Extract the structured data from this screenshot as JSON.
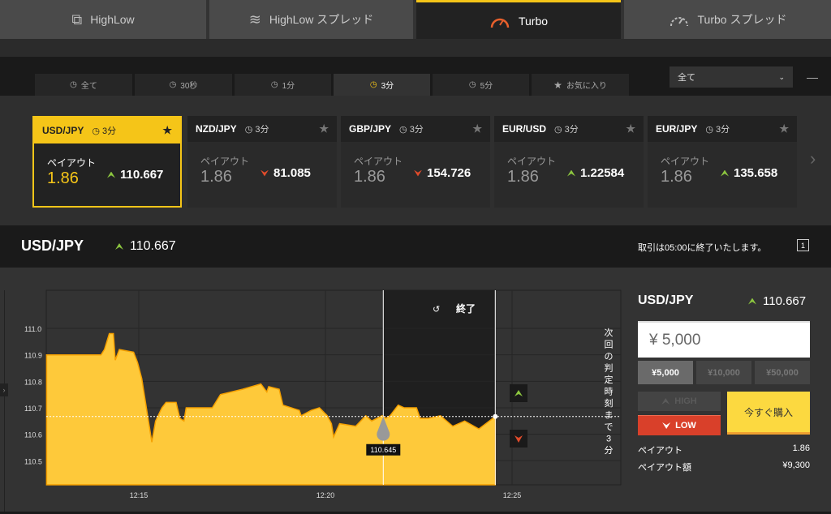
{
  "top_tabs": [
    {
      "label": "HighLow",
      "icon": "highlow-icon"
    },
    {
      "label": "HighLow スプレッド",
      "icon": "highlow-spread-icon"
    },
    {
      "label": "Turbo",
      "icon": "speedometer-icon"
    },
    {
      "label": "Turbo スプレッド",
      "icon": "speedometer-dashed-icon"
    }
  ],
  "filter_tabs": [
    "全て",
    "30秒",
    "1分",
    "3分",
    "5分",
    "お気に入り"
  ],
  "dropdown": {
    "value": "全て"
  },
  "cards": [
    {
      "pair": "USD/JPY",
      "time": "3分",
      "payout_label": "ペイアウト",
      "payout": "1.86",
      "rate": "110.667",
      "dir": "up"
    },
    {
      "pair": "NZD/JPY",
      "time": "3分",
      "payout_label": "ペイアウト",
      "payout": "1.86",
      "rate": "81.085",
      "dir": "down"
    },
    {
      "pair": "GBP/JPY",
      "time": "3分",
      "payout_label": "ペイアウト",
      "payout": "1.86",
      "rate": "154.726",
      "dir": "down"
    },
    {
      "pair": "EUR/USD",
      "time": "3分",
      "payout_label": "ペイアウト",
      "payout": "1.86",
      "rate": "1.22584",
      "dir": "up"
    },
    {
      "pair": "EUR/JPY",
      "time": "3分",
      "payout_label": "ペイアウト",
      "payout": "1.86",
      "rate": "135.658",
      "dir": "up"
    }
  ],
  "header": {
    "pair": "USD/JPY",
    "rate": "110.667",
    "notice": "取引は05:00に終了いたします。",
    "window_icon_label": "1"
  },
  "chart_data": {
    "type": "area",
    "y_ticks": [
      "111.0",
      "110.9",
      "110.8",
      "110.7",
      "110.6",
      "110.5"
    ],
    "x_ticks": [
      "12:15",
      "12:20",
      "12:25"
    ],
    "ylim": [
      110.4,
      111.15
    ],
    "x_unit": "minutes after 12:00",
    "points": [
      [
        12.53,
        110.9
      ],
      [
        13.99,
        110.9
      ],
      [
        14.08,
        110.92
      ],
      [
        14.21,
        110.98
      ],
      [
        14.32,
        110.98
      ],
      [
        14.37,
        110.88
      ],
      [
        14.48,
        110.92
      ],
      [
        14.86,
        110.91
      ],
      [
        14.97,
        110.87
      ],
      [
        15.08,
        110.81
      ],
      [
        15.18,
        110.72
      ],
      [
        15.35,
        110.57
      ],
      [
        15.45,
        110.65
      ],
      [
        15.62,
        110.7
      ],
      [
        15.73,
        110.72
      ],
      [
        16.0,
        110.72
      ],
      [
        16.1,
        110.66
      ],
      [
        16.21,
        110.65
      ],
      [
        16.27,
        110.7
      ],
      [
        16.7,
        110.7
      ],
      [
        16.97,
        110.7
      ],
      [
        17.19,
        110.75
      ],
      [
        17.78,
        110.77
      ],
      [
        18.27,
        110.79
      ],
      [
        18.43,
        110.76
      ],
      [
        18.48,
        110.78
      ],
      [
        18.76,
        110.77
      ],
      [
        18.86,
        110.71
      ],
      [
        19.3,
        110.69
      ],
      [
        19.35,
        110.67
      ],
      [
        19.62,
        110.69
      ],
      [
        19.84,
        110.7
      ],
      [
        20.05,
        110.67
      ],
      [
        20.16,
        110.64
      ],
      [
        20.22,
        110.59
      ],
      [
        20.38,
        110.64
      ],
      [
        20.81,
        110.63
      ],
      [
        21.08,
        110.67
      ],
      [
        21.24,
        110.65
      ],
      [
        21.52,
        110.67
      ],
      [
        21.62,
        110.66
      ],
      [
        21.73,
        110.67
      ],
      [
        21.95,
        110.71
      ],
      [
        22.11,
        110.7
      ],
      [
        22.44,
        110.7
      ],
      [
        22.54,
        110.66
      ],
      [
        22.76,
        110.66
      ],
      [
        23.08,
        110.67
      ],
      [
        23.41,
        110.63
      ],
      [
        23.73,
        110.65
      ],
      [
        24.11,
        110.62
      ],
      [
        24.55,
        110.667
      ]
    ],
    "current_rate": 110.667,
    "entry_time": 21.55,
    "entry_label": "110.645",
    "expiry_time": 24.55,
    "expiry_label": "終了",
    "countdown_label": "次回の判定時刻まで3分"
  },
  "trade": {
    "pair": "USD/JPY",
    "rate": "110.667",
    "amount": "¥ 5,000",
    "presets": [
      "¥5,000",
      "¥10,000",
      "¥50,000"
    ],
    "high": "HIGH",
    "low": "LOW",
    "buy": "今すぐ購入",
    "payout_label": "ペイアウト",
    "payout": "1.86",
    "payout_amount_label": "ペイアウト額",
    "payout_amount": "¥9,300"
  }
}
